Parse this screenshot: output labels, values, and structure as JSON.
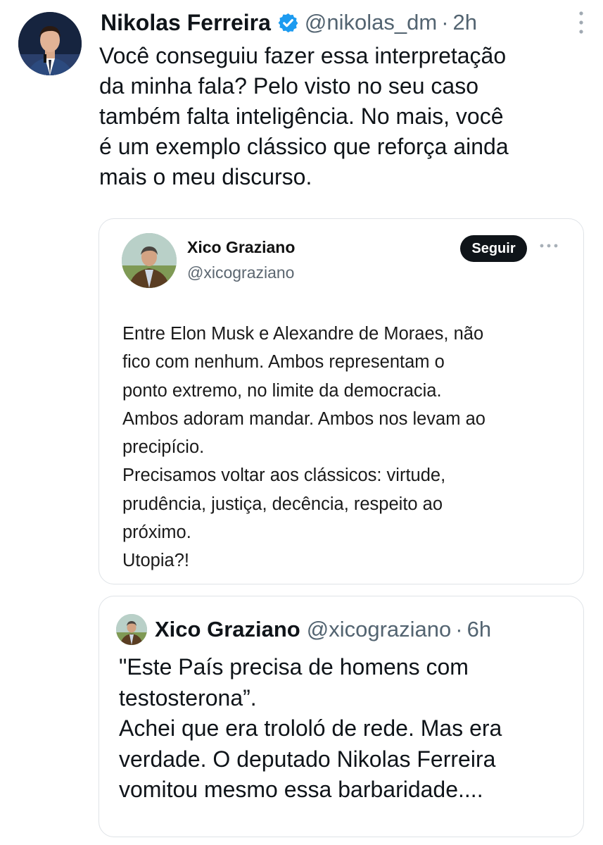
{
  "tweet": {
    "author_name": "Nikolas Ferreira",
    "handle": "@nikolas_dm",
    "separator": "·",
    "time": "2h",
    "text": "Você conseguiu fazer essa interpretação\nda minha fala? Pelo visto no seu caso\ntambém falta inteligência. No mais, você\né um exemplo clássico que reforça ainda\nmais o meu discurso."
  },
  "embedded_screenshot": {
    "author_name": "Xico Graziano",
    "handle": "@xicograziano",
    "follow_label": "Seguir",
    "text": "Entre Elon Musk e Alexandre de Moraes, não\nfico com nenhum. Ambos representam o\nponto extremo, no limite da democracia.\nAmbos adoram mandar. Ambos nos levam ao\nprecipício.\nPrecisamos voltar aos clássicos: virtude,\nprudência, justiça, decência, respeito ao\npróximo.\nUtopia?!"
  },
  "quoted_tweet": {
    "author_name": "Xico Graziano",
    "handle": "@xicograziano",
    "separator": "·",
    "time": "6h",
    "text": "\"Este País precisa de homens com\ntestosterona”.\nAchei que era trololó de rede. Mas era\nverdade. O deputado Nikolas Ferreira\nvomitou mesmo essa barbaridade...."
  },
  "icons": {
    "verified": "verified-badge-icon",
    "more": "more-vertical-icon",
    "embed_more": "more-horizontal-icon"
  },
  "colors": {
    "verified_blue": "#1d9bf0",
    "secondary_text": "#536471",
    "follow_button_bg": "#0f1419"
  }
}
